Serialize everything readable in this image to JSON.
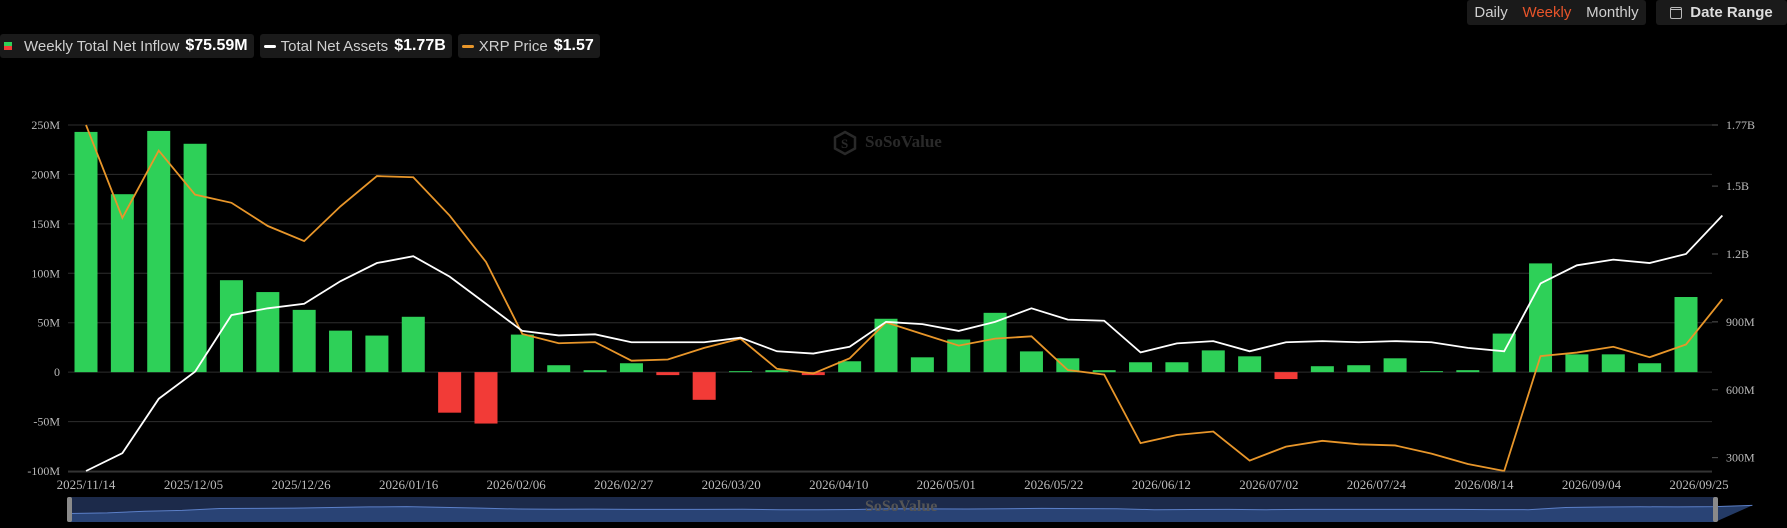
{
  "legend": {
    "inflow_label": "Weekly Total Net Inflow",
    "inflow_value": "$75.59M",
    "assets_label": "Total Net Assets",
    "assets_value": "$1.77B",
    "price_label": "XRP Price",
    "price_value": "$1.57"
  },
  "period_tabs": [
    "Daily",
    "Weekly",
    "Monthly"
  ],
  "active_period": "Weekly",
  "date_range_label": "Date Range",
  "watermark": "SoSoValue",
  "colors": {
    "positive": "#2ed058",
    "negative": "#f23b37",
    "assets_line": "#ffffff",
    "price_line": "#e8962a",
    "active_tab": "#e8542a"
  },
  "chart_data": {
    "type": "bar",
    "x_ticks": [
      "2025/11/14",
      "2025/12/05",
      "2025/12/26",
      "2026/01/16",
      "2026/02/06",
      "2026/02/27",
      "2026/03/20",
      "2026/04/10",
      "2026/05/01",
      "2026/05/22",
      "2026/06/12",
      "2026/07/02",
      "2026/07/24",
      "2026/08/14",
      "2026/09/04",
      "2026/09/25"
    ],
    "y_left_ticks": [
      "250M",
      "200M",
      "150M",
      "100M",
      "50M",
      "0",
      "-50M",
      "-100M"
    ],
    "y_left_range": [
      -100,
      250
    ],
    "y_right_ticks": [
      "1.77B",
      "1.5B",
      "1.2B",
      "900M",
      "600M",
      "300M"
    ],
    "y_right_values": [
      1.77,
      1.5,
      1.2,
      0.9,
      0.6,
      0.3
    ],
    "y_right_range": [
      0.241,
      1.77
    ],
    "legend_position": "top-left",
    "grid": true,
    "series": [
      {
        "name": "Weekly Total Net Inflow",
        "kind": "bar",
        "unit": "M",
        "values": [
          243,
          180,
          244,
          231,
          93,
          81,
          63,
          42,
          37,
          56,
          -41,
          -52,
          38,
          7,
          2,
          9,
          -3,
          -28,
          1,
          2,
          -3,
          11,
          54,
          15,
          33,
          60,
          21,
          14,
          2,
          10,
          10,
          22,
          16,
          -7,
          6,
          7,
          14,
          1,
          2,
          39,
          110,
          18,
          18,
          9,
          76
        ]
      },
      {
        "name": "Total Net Assets",
        "kind": "line",
        "unit": "B",
        "values": [
          0.241,
          0.32,
          0.56,
          0.68,
          0.93,
          0.96,
          0.98,
          1.08,
          1.16,
          1.19,
          1.1,
          0.98,
          0.86,
          0.84,
          0.845,
          0.81,
          0.81,
          0.81,
          0.83,
          0.77,
          0.76,
          0.79,
          0.9,
          0.89,
          0.86,
          0.9,
          0.96,
          0.91,
          0.905,
          0.765,
          0.805,
          0.815,
          0.77,
          0.81,
          0.815,
          0.81,
          0.815,
          0.81,
          0.785,
          0.77,
          1.07,
          1.15,
          1.175,
          1.16,
          1.2,
          1.37
        ]
      },
      {
        "name": "XRP Price",
        "kind": "line",
        "unit": "USD",
        "values": [
          3.3,
          2.5,
          3.08,
          2.7,
          2.63,
          2.43,
          2.3,
          2.6,
          2.86,
          2.85,
          2.52,
          2.12,
          1.5,
          1.42,
          1.43,
          1.27,
          1.28,
          1.38,
          1.46,
          1.2,
          1.16,
          1.29,
          1.6,
          1.5,
          1.4,
          1.46,
          1.48,
          1.19,
          1.15,
          0.56,
          0.63,
          0.66,
          0.41,
          0.53,
          0.58,
          0.55,
          0.54,
          0.47,
          0.38,
          0.32,
          1.31,
          1.34,
          1.39,
          1.3,
          1.41,
          1.8
        ]
      }
    ]
  }
}
